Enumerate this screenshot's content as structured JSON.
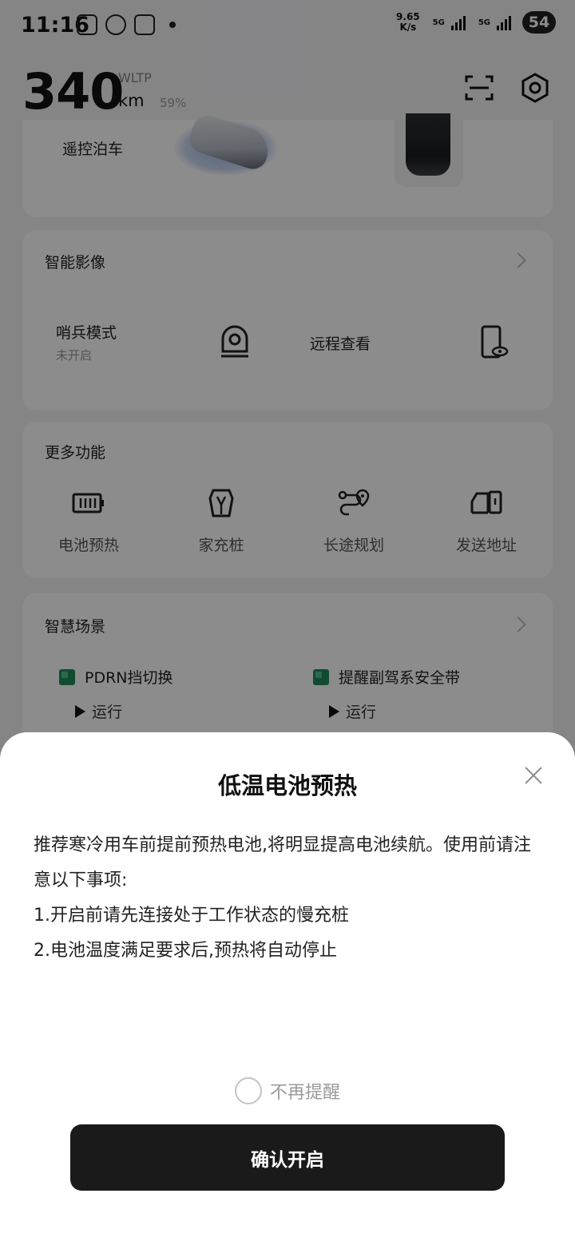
{
  "status_bar": {
    "time": "11:16",
    "net_speed_value": "9.65",
    "net_speed_unit": "K/s",
    "network_1": "5G",
    "network_2": "5G",
    "battery": "54"
  },
  "header": {
    "range_value": "340",
    "range_standard": "WLTP",
    "range_unit": "km",
    "battery_percent": "59%"
  },
  "parking": {
    "label": "遥控泊车"
  },
  "smart_imaging": {
    "title": "智能影像",
    "sentry_label": "哨兵模式",
    "sentry_status": "未开启",
    "remote_view_label": "远程查看"
  },
  "more_functions": {
    "title": "更多功能",
    "items": [
      {
        "label": "电池预热",
        "icon": "battery-heat-icon"
      },
      {
        "label": "家充桩",
        "icon": "home-charger-icon"
      },
      {
        "label": "长途规划",
        "icon": "route-plan-icon"
      },
      {
        "label": "发送地址",
        "icon": "send-address-icon"
      }
    ]
  },
  "smart_scenes": {
    "title": "智慧场景",
    "items": [
      {
        "title": "PDRN挡切换",
        "run_label": "运行"
      },
      {
        "title": "提醒副驾系安全带",
        "run_label": "运行"
      }
    ]
  },
  "sheet": {
    "title": "低温电池预热",
    "intro": "推荐寒冷用车前提前预热电池,将明显提高电池续航。使用前请注意以下事项:",
    "item_1": "1.开启前请先连接处于工作状态的慢充桩",
    "item_2": "2.电池温度满足要求后,预热将自动停止",
    "dont_remind_label": "不再提醒",
    "confirm_label": "确认开启"
  }
}
